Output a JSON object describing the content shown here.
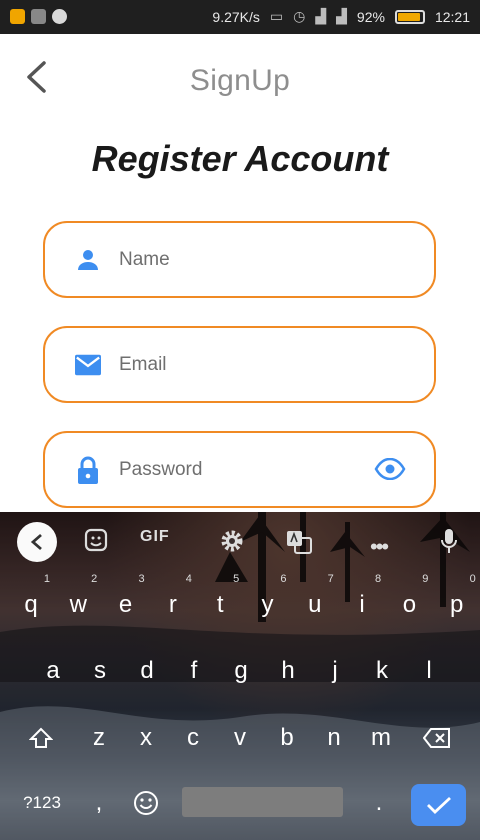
{
  "status_bar": {
    "network_speed": "9.27K/s",
    "battery_percent": "92%",
    "battery_level": 0.92,
    "time": "12:21"
  },
  "app_bar": {
    "title": "SignUp",
    "back_icon": "chevron-left-icon"
  },
  "heading": "Register Account",
  "fields": {
    "name": {
      "placeholder": "Name",
      "icon": "person-icon"
    },
    "email": {
      "placeholder": "Email",
      "icon": "mail-icon"
    },
    "password": {
      "placeholder": "Password",
      "icon": "lock-icon",
      "toggle_icon": "eye-icon"
    }
  },
  "colors": {
    "field_border": "#f08a24",
    "icon_blue": "#3d8ef0",
    "heading": "#1a1a1a",
    "title": "#8e8e8e"
  },
  "keyboard": {
    "toolbar": {
      "gif_label": "GIF"
    },
    "row1": [
      {
        "k": "q",
        "n": "1"
      },
      {
        "k": "w",
        "n": "2"
      },
      {
        "k": "e",
        "n": "3"
      },
      {
        "k": "r",
        "n": "4"
      },
      {
        "k": "t",
        "n": "5"
      },
      {
        "k": "y",
        "n": "6"
      },
      {
        "k": "u",
        "n": "7"
      },
      {
        "k": "i",
        "n": "8"
      },
      {
        "k": "o",
        "n": "9"
      },
      {
        "k": "p",
        "n": "0"
      }
    ],
    "row2": [
      "a",
      "s",
      "d",
      "f",
      "g",
      "h",
      "j",
      "k",
      "l"
    ],
    "row3": [
      "z",
      "x",
      "c",
      "v",
      "b",
      "n",
      "m"
    ],
    "symbols_label": "?123",
    "comma": ",",
    "period": "."
  }
}
